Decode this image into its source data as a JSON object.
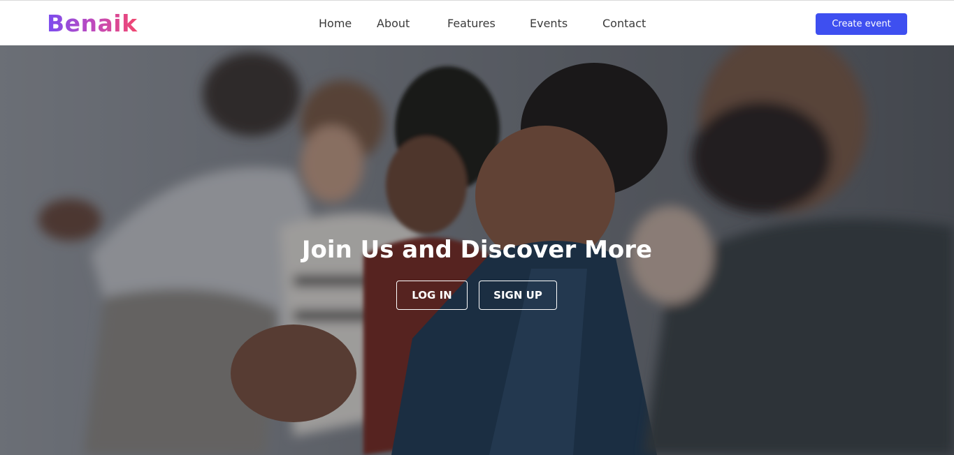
{
  "header": {
    "logo_text": "Benaik",
    "nav": {
      "home": "Home",
      "about": "About",
      "features": "Features",
      "events": "Events",
      "contact": "Contact"
    },
    "create_event_label": "Create event"
  },
  "hero": {
    "title": "Join Us and Discover More",
    "login_label": "LOG IN",
    "signup_label": "SIGN UP",
    "image_description": "blurred photo of an audience applauding"
  },
  "colors": {
    "accent": "#3e4ff0",
    "logo_gradient_start": "#7a4cf0",
    "logo_gradient_end": "#f2466e",
    "nav_text": "#3a3a3a"
  }
}
